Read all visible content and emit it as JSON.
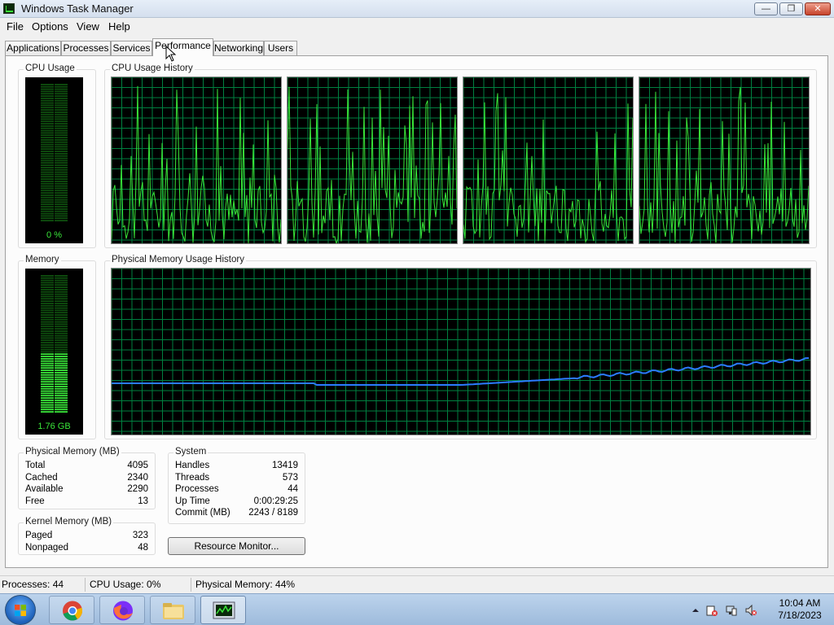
{
  "window": {
    "title": "Windows Task Manager",
    "buttons": {
      "minimize": "—",
      "maximize": "❐",
      "close": "✕"
    }
  },
  "menu": [
    "File",
    "Options",
    "View",
    "Help"
  ],
  "tabs": [
    "Applications",
    "Processes",
    "Services",
    "Performance",
    "Networking",
    "Users"
  ],
  "active_tab": "Performance",
  "performance": {
    "cpu_usage": {
      "label": "CPU Usage",
      "value_text": "0 %",
      "fraction": 0.0
    },
    "cpu_history_label": "CPU Usage History",
    "memory": {
      "label": "Memory",
      "value_text": "1.76 GB",
      "fraction": 0.43
    },
    "memory_history_label": "Physical Memory Usage History",
    "physical_memory": {
      "label": "Physical Memory (MB)",
      "rows": [
        {
          "label": "Total",
          "value": "4095"
        },
        {
          "label": "Cached",
          "value": "2340"
        },
        {
          "label": "Available",
          "value": "2290"
        },
        {
          "label": "Free",
          "value": "13"
        }
      ]
    },
    "kernel_memory": {
      "label": "Kernel Memory (MB)",
      "rows": [
        {
          "label": "Paged",
          "value": "323"
        },
        {
          "label": "Nonpaged",
          "value": "48"
        }
      ]
    },
    "system": {
      "label": "System",
      "rows": [
        {
          "label": "Handles",
          "value": "13419"
        },
        {
          "label": "Threads",
          "value": "573"
        },
        {
          "label": "Processes",
          "value": "44"
        },
        {
          "label": "Up Time",
          "value": "0:00:29:25"
        },
        {
          "label": "Commit (MB)",
          "value": "2243 / 8189"
        }
      ]
    },
    "resource_monitor_button": "Resource Monitor..."
  },
  "status": {
    "processes": "Processes: 44",
    "cpu": "CPU Usage: 0%",
    "memory": "Physical Memory: 44%"
  },
  "taskbar": {
    "apps": [
      "start-orb",
      "chrome",
      "firefox",
      "file-explorer",
      "task-manager"
    ],
    "clock_time": "10:04 AM",
    "clock_date": "7/18/2023"
  },
  "colors": {
    "graph_grid": "#008040",
    "cpu_line": "#39e639",
    "mem_line": "#2b7bff",
    "meter_on": "#39e639",
    "meter_off": "#0e4e0e"
  }
}
